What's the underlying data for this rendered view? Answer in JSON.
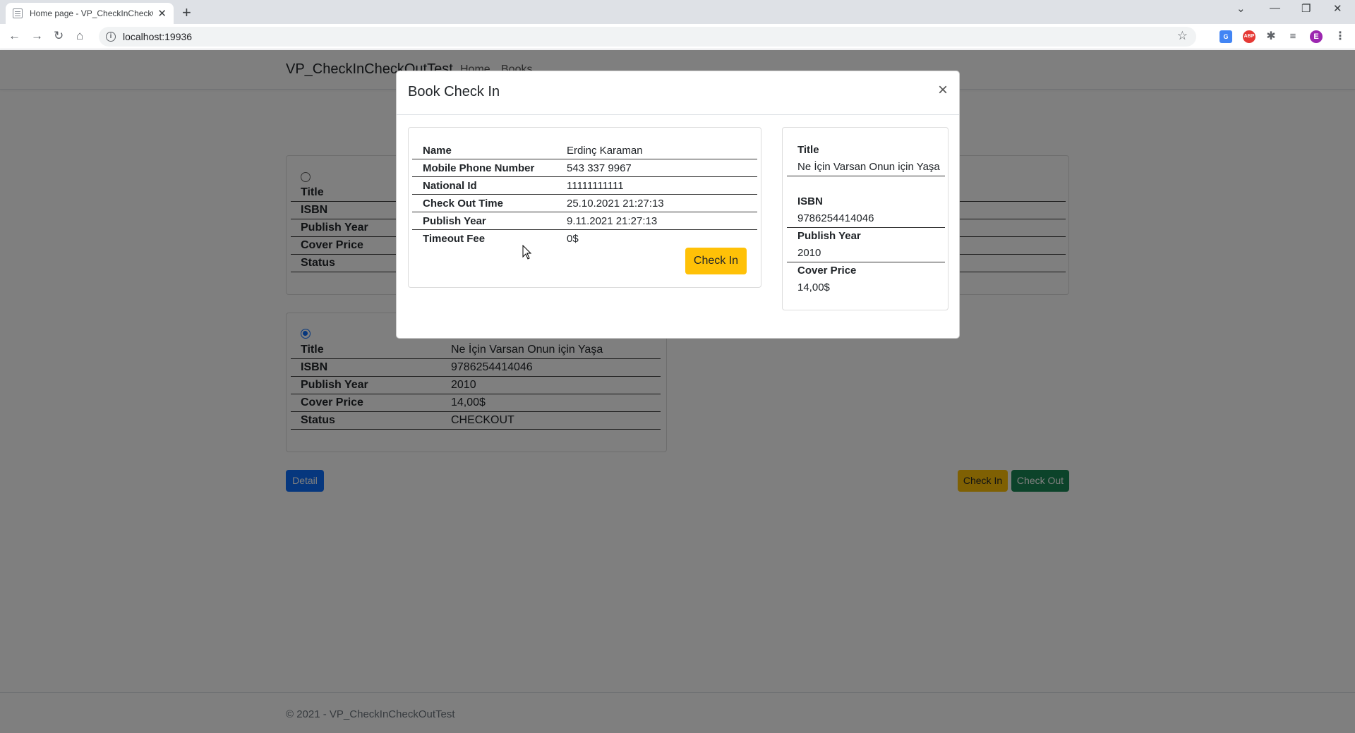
{
  "browser": {
    "tab_title": "Home page - VP_CheckInCheckO",
    "url": "localhost:19936",
    "profile_initial": "E",
    "abp_label": "ABP"
  },
  "site": {
    "brand": "VP_CheckInCheckOutTest",
    "nav": [
      "Home",
      "Books"
    ],
    "footer": "© 2021 - VP_CheckInCheckOutTest"
  },
  "books": {
    "labels": {
      "title": "Title",
      "isbn": "ISBN",
      "publish_year": "Publish Year",
      "cover_price": "Cover Price",
      "status": "Status"
    },
    "selected": {
      "title": "Ne İçin Varsan Onun için Yaşa",
      "isbn": "9786254414046",
      "publish_year": "2010",
      "cover_price": "14,00$",
      "status": "CHECKOUT"
    }
  },
  "actions": {
    "detail": "Detail",
    "check_in": "Check In",
    "check_out": "Check Out"
  },
  "colors": {
    "primary": "#0d6efd",
    "warning": "#ffc107",
    "success": "#198754"
  },
  "modal": {
    "title": "Book Check In",
    "close": "×",
    "member": [
      {
        "label": "Name",
        "value": "Erdinç Karaman"
      },
      {
        "label": "Mobile Phone Number",
        "value": "543 337 9967"
      },
      {
        "label": "National Id",
        "value": "11111111111"
      },
      {
        "label": "Check Out Time",
        "value": "25.10.2021 21:27:13"
      },
      {
        "label": "Publish Year",
        "value": "9.11.2021 21:27:13"
      },
      {
        "label": "Timeout Fee",
        "value": "0$"
      }
    ],
    "check_in_button": "Check In",
    "book": {
      "title_label": "Title",
      "title": "Ne İçin Varsan Onun için Yaşa",
      "isbn_label": "ISBN",
      "isbn": "9786254414046",
      "publish_year_label": "Publish Year",
      "publish_year": "2010",
      "cover_price_label": "Cover Price",
      "cover_price": "14,00$"
    }
  }
}
